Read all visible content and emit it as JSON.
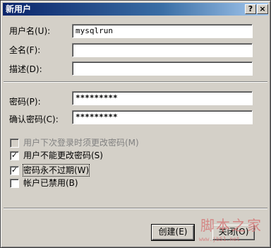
{
  "window": {
    "title": "新用户",
    "help_button": "?",
    "close_button": "×"
  },
  "fields": {
    "username_label": "用户名(U):",
    "username_value": "mysqlrun",
    "fullname_label": "全名(F):",
    "fullname_value": "",
    "description_label": "描述(D):",
    "description_value": "",
    "password_label": "密码(P):",
    "password_value": "*********",
    "confirm_label": "确认密码(C):",
    "confirm_value": "*********"
  },
  "options": [
    {
      "label": "用户下次登录时须更改密码(M)",
      "checked": false,
      "disabled": true
    },
    {
      "label": "用户不能更改密码(S)",
      "checked": true,
      "disabled": false
    },
    {
      "label": "密码永不过期(W)",
      "checked": true,
      "disabled": false
    },
    {
      "label": "帐户已禁用(B)",
      "checked": false,
      "disabled": false
    }
  ],
  "buttons": {
    "create_label": "创建(E)",
    "close_label": "关闭(O)"
  },
  "watermark": {
    "text": "脚本之家",
    "url": "www.jb51.net"
  }
}
